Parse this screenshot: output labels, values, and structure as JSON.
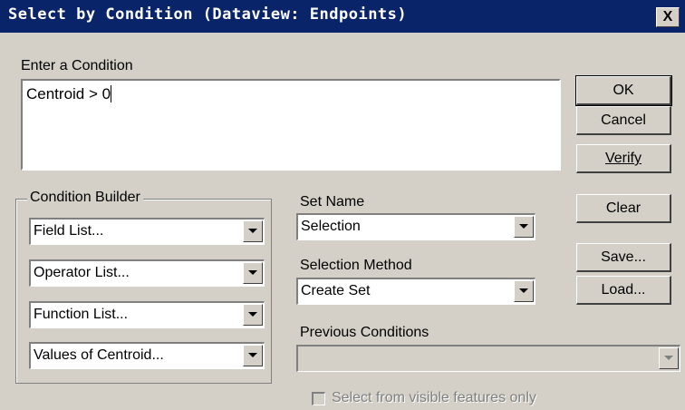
{
  "window": {
    "title": "Select by Condition (Dataview: Endpoints)",
    "close_label": "X"
  },
  "condition": {
    "label": "Enter a Condition",
    "value": "Centroid > 0"
  },
  "buttons": {
    "ok": "OK",
    "cancel": "Cancel",
    "verify": "Verify",
    "clear": "Clear",
    "save": "Save...",
    "load": "Load..."
  },
  "condition_builder": {
    "label": "Condition Builder",
    "field_list": "Field List...",
    "operator_list": "Operator List...",
    "function_list": "Function List...",
    "values_list": "Values of Centroid..."
  },
  "set_name": {
    "label": "Set Name",
    "value": "Selection"
  },
  "selection_method": {
    "label": "Selection Method",
    "value": "Create Set"
  },
  "previous_conditions": {
    "label": "Previous Conditions",
    "value": ""
  },
  "visible_only": {
    "label": "Select from visible features only",
    "checked": false
  },
  "colors": {
    "titlebar": "#0a246a",
    "face": "#d4d0c8"
  }
}
